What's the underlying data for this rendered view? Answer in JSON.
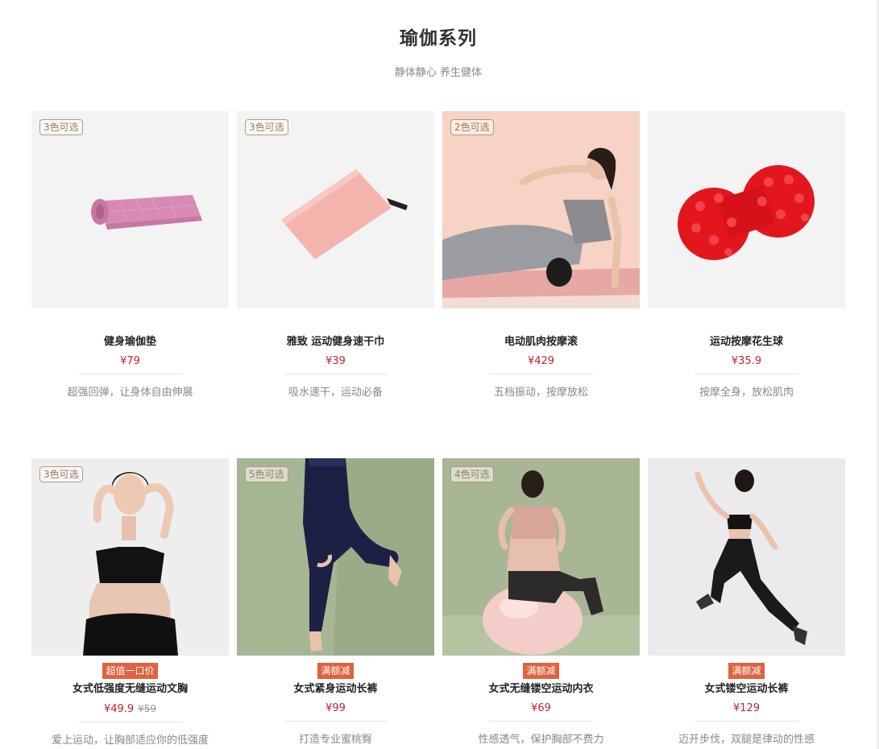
{
  "section": {
    "title": "瑜伽系列",
    "subtitle": "静体静心 养生健体"
  },
  "products": [
    {
      "name": "健身瑜伽垫",
      "price": "¥79",
      "desc": "超强回弹，让身体自由伸展",
      "color_tag": "3色可选",
      "promo": "",
      "old_price": ""
    },
    {
      "name": "雅致 运动健身速干巾",
      "price": "¥39",
      "desc": "吸水速干，运动必备",
      "color_tag": "3色可选",
      "promo": "",
      "old_price": ""
    },
    {
      "name": "电动肌肉按摩滚",
      "price": "¥429",
      "desc": "五档振动，按摩放松",
      "color_tag": "2色可选",
      "promo": "",
      "old_price": ""
    },
    {
      "name": "运动按摩花生球",
      "price": "¥35.9",
      "desc": "按摩全身，放松肌肉",
      "color_tag": "",
      "promo": "",
      "old_price": ""
    },
    {
      "name": "女式低强度无缝运动文胸",
      "price": "¥49.9",
      "desc": "爱上运动，让胸部适应你的低强度",
      "color_tag": "3色可选",
      "promo": "超值一口价",
      "old_price": "¥59"
    },
    {
      "name": "女式紧身运动长裤",
      "price": "¥99",
      "desc": "打造专业蜜桃臀",
      "color_tag": "5色可选",
      "promo": "满额减",
      "old_price": ""
    },
    {
      "name": "女式无缝镂空运动内衣",
      "price": "¥69",
      "desc": "性感透气，保护胸部不费力",
      "color_tag": "4色可选",
      "promo": "满额减",
      "old_price": ""
    },
    {
      "name": "女式镂空运动长裤",
      "price": "¥129",
      "desc": "迈开步伐，双腿是律动的性感",
      "color_tag": "",
      "promo": "满额减",
      "old_price": ""
    }
  ],
  "colors": {
    "price": "#c8202f",
    "promo_bg": "#e0623e",
    "tag_border": "#b59a7a"
  }
}
